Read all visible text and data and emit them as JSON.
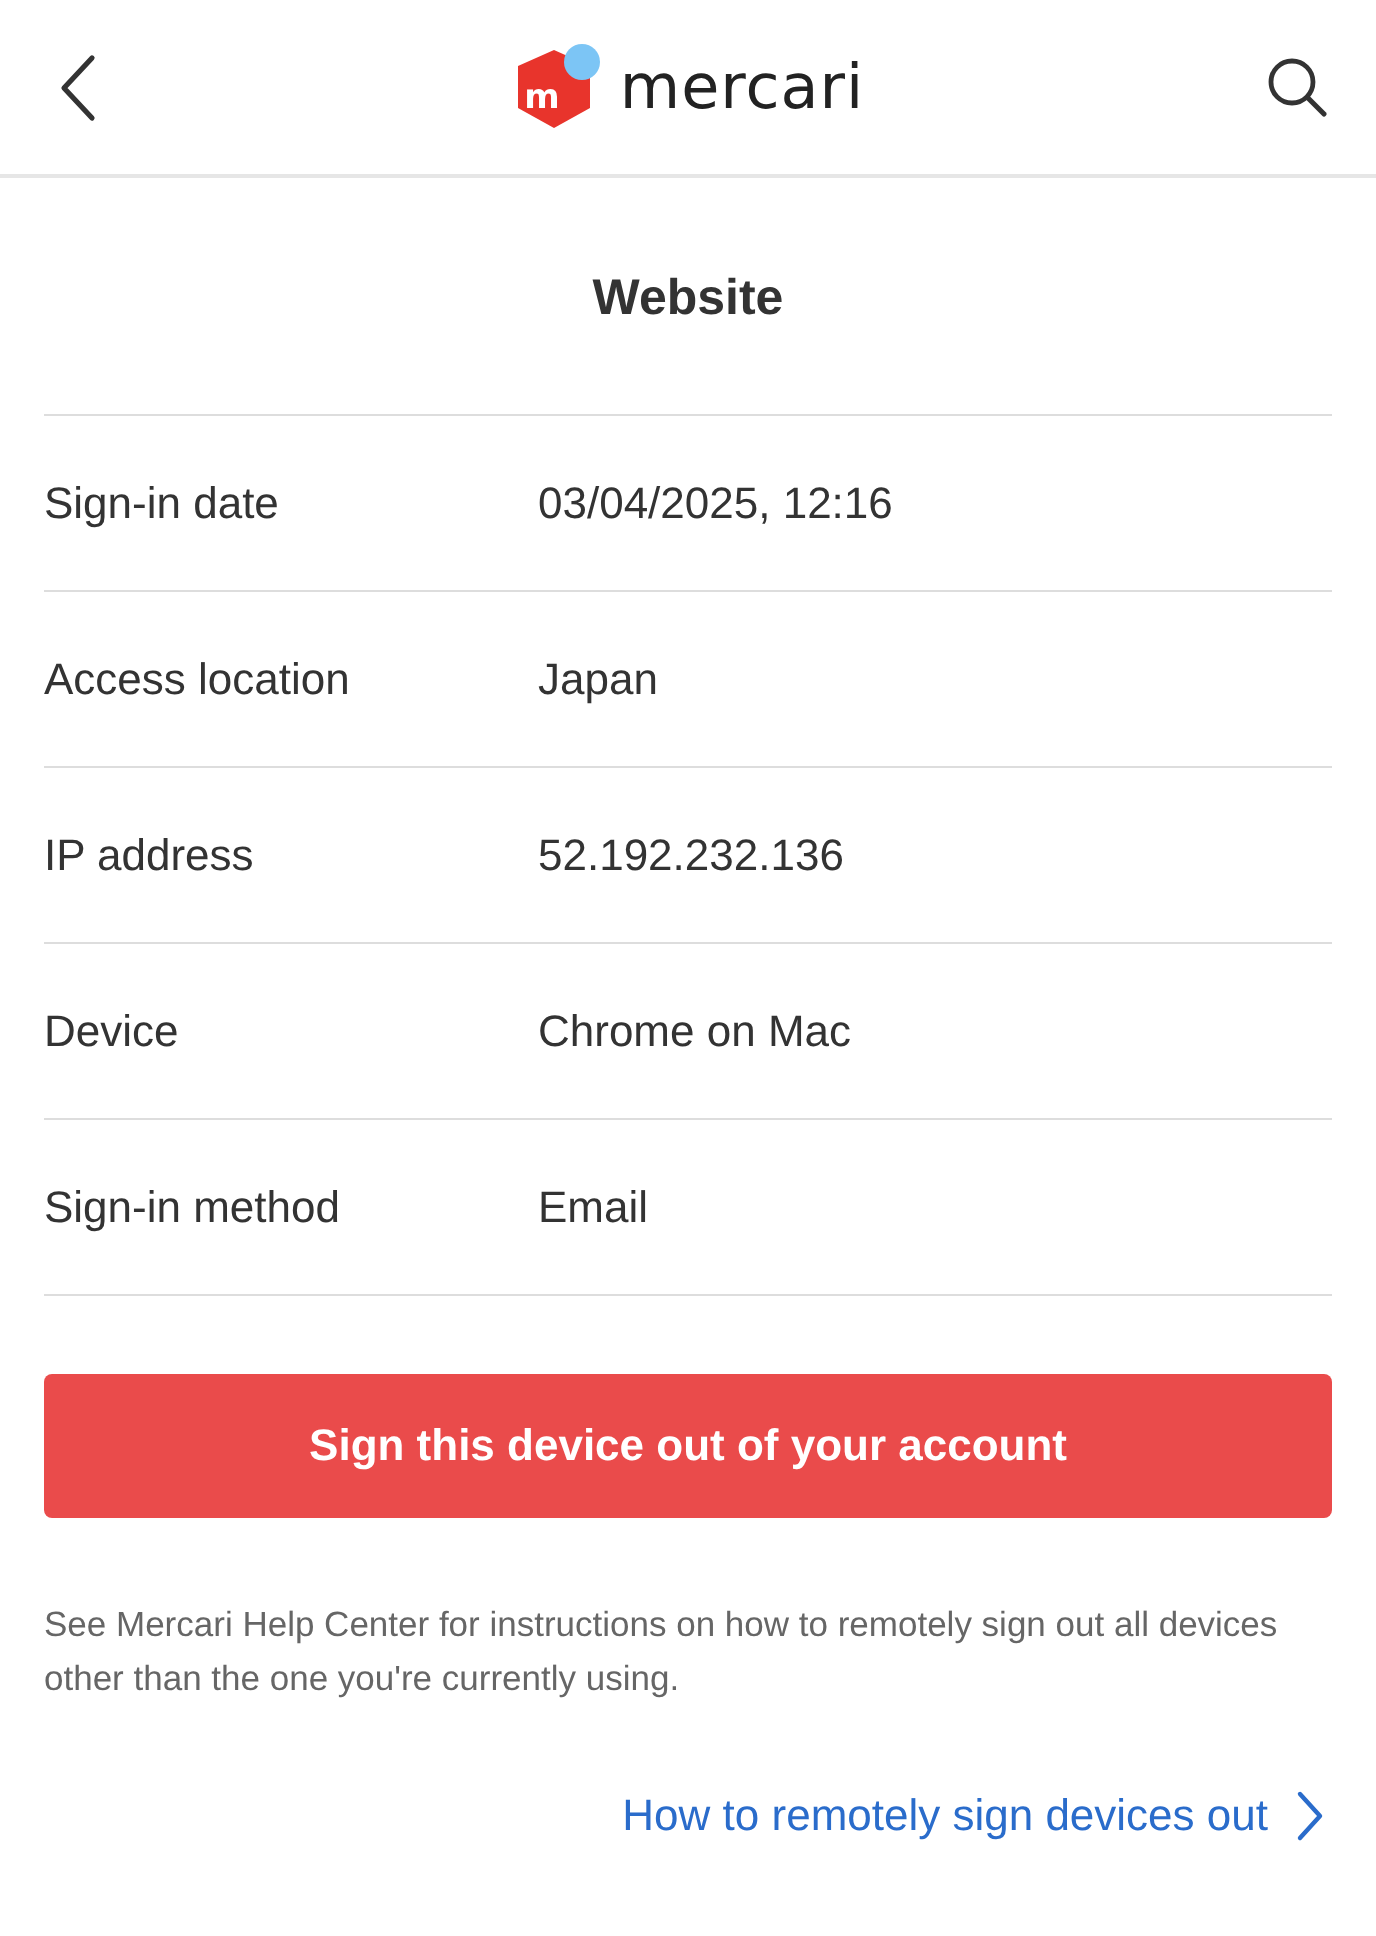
{
  "header": {
    "logo_mark": "m",
    "logo_text": "mercari"
  },
  "title": "Website",
  "details": [
    {
      "label": "Sign-in date",
      "value": "03/04/2025, 12:16"
    },
    {
      "label": "Access location",
      "value": "Japan"
    },
    {
      "label": "IP address",
      "value": "52.192.232.136"
    },
    {
      "label": "Device",
      "value": "Chrome on Mac"
    },
    {
      "label": "Sign-in method",
      "value": "Email"
    }
  ],
  "sign_out_button": "Sign this device out of your account",
  "note": "See Mercari Help Center for instructions on how to remotely sign out all devices other than the one you're currently using.",
  "help_link": "How to remotely sign devices out"
}
